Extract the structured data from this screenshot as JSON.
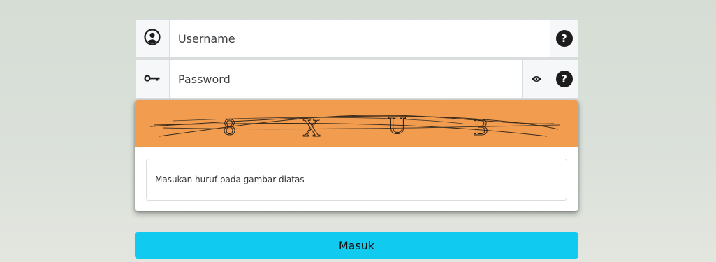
{
  "username": {
    "placeholder": "Username",
    "icon": "user-circle-icon",
    "help_icon": "question-icon",
    "help_text": "?"
  },
  "password": {
    "placeholder": "Password",
    "icon": "key-icon",
    "toggle_icon": "eye-icon",
    "help_icon": "question-icon",
    "help_text": "?"
  },
  "captcha": {
    "image_background": "#f29c4f",
    "characters": [
      "8",
      "X",
      "U",
      "B"
    ],
    "input_placeholder": "Masukan huruf pada gambar diatas"
  },
  "submit": {
    "label": "Masuk",
    "color": "#10caf0"
  }
}
